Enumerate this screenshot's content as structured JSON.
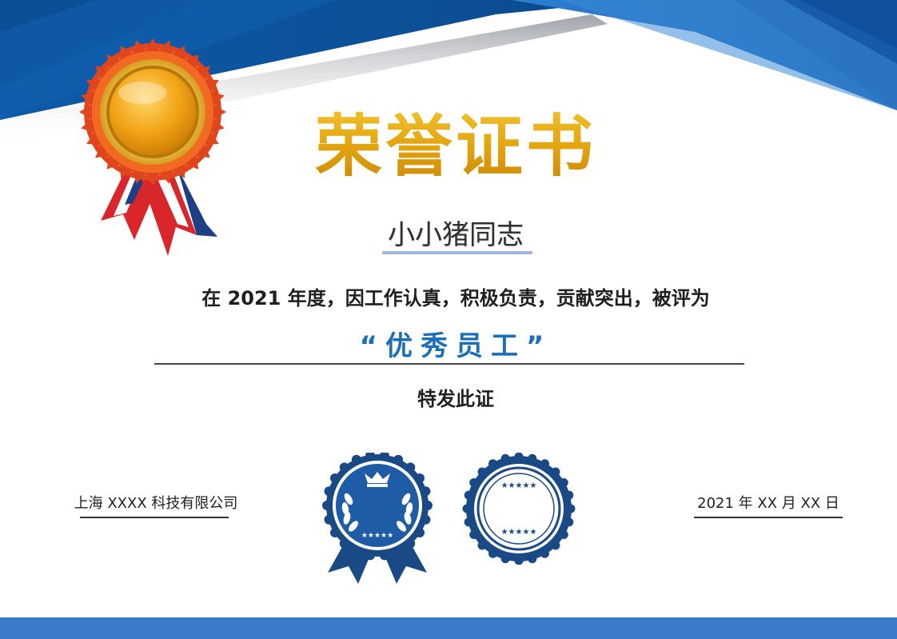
{
  "certificate": {
    "title": "荣誉证书",
    "recipient": "小小猪同志",
    "citation": "在 2021 年度，因工作认真，积极负责，贡献突出，被评为",
    "award": "“优秀员工”",
    "issue_text": "特发此证",
    "company": "上海 XXXX 科技有限公司",
    "date": "2021 年 XX 月 XX 日"
  },
  "icons": {
    "top_medal": "gold-rosette-medal-icon",
    "seal_left": "laurel-crown-seal-icon",
    "seal_right": "star-ring-seal-icon"
  },
  "colors": {
    "primary_blue": "#1f5fa8",
    "dark_blue": "#0f3f7a",
    "gold": "#e0a10e",
    "award_blue": "#1a6fb8",
    "bottom_bar": "#3a7ac9"
  }
}
